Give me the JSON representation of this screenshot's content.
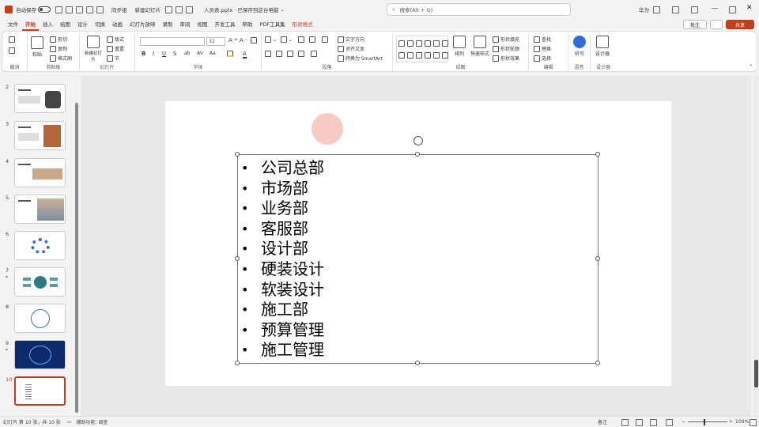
{
  "titlebar": {
    "autosave_label": "自动保存",
    "toggle_state": "关",
    "workspace_label": "同步组",
    "layout_label": "新建幻灯片",
    "file_title": "人员表.pptx · 已保存到这台电脑",
    "search_placeholder": "搜索(Alt + Q)",
    "user": "华为"
  },
  "menu": {
    "items": [
      "文件",
      "开始",
      "插入",
      "绘图",
      "设计",
      "切换",
      "动画",
      "幻灯片放映",
      "录制",
      "审阅",
      "视图",
      "开发工具",
      "帮助",
      "PDF工具集",
      "形状格式"
    ],
    "active": "开始",
    "contextual": "形状格式"
  },
  "header_buttons": {
    "comment": "批注",
    "share": "共享"
  },
  "ribbon": {
    "groups": [
      {
        "label": "撤消"
      },
      {
        "label": "剪贴板"
      },
      {
        "label": "幻灯片"
      },
      {
        "label": "字体"
      },
      {
        "label": "段落"
      },
      {
        "label": "绘图"
      },
      {
        "label": "编辑"
      },
      {
        "label": "语音"
      },
      {
        "label": "设计器"
      }
    ],
    "clipboard": {
      "paste": "粘贴",
      "cut": "剪切",
      "copy": "复制",
      "format_painter": "格式刷"
    },
    "slides": {
      "new_slide": "新建幻灯片",
      "layout": "版式",
      "reset": "重置",
      "section": "节"
    },
    "font": {
      "font_name": "",
      "font_size": "32"
    },
    "paragraph": {
      "text_direction": "文字方向",
      "align_text": "对齐文本",
      "smartart": "转换为 SmartArt"
    },
    "drawing": {
      "arrange": "排列",
      "quick_styles": "快速样式",
      "fill": "形状填充",
      "outline": "形状轮廓",
      "effects": "形状效果"
    },
    "editing": {
      "find": "查找",
      "replace": "替换",
      "select": "选择"
    },
    "voice": {
      "dictate": "听写"
    },
    "designer": {
      "designer": "设计器"
    }
  },
  "thumbnails": [
    {
      "num": "2",
      "style": "content"
    },
    {
      "num": "3",
      "style": "content"
    },
    {
      "num": "4",
      "style": "content"
    },
    {
      "num": "5",
      "style": "photo"
    },
    {
      "num": "6",
      "style": "dots"
    },
    {
      "num": "7",
      "style": "diagram",
      "star": "*"
    },
    {
      "num": "8",
      "style": "circle"
    },
    {
      "num": "9",
      "style": "dark",
      "star": "*"
    },
    {
      "num": "10",
      "style": "list",
      "selected": true
    }
  ],
  "slide": {
    "bullets": [
      "公司总部",
      "市场部",
      "业务部",
      "客服部",
      "设计部",
      "硬装设计",
      "软装设计",
      "施工部",
      "预算管理",
      "施工管理"
    ]
  },
  "status": {
    "slide_info": "幻灯片 第 10 张，共 10 张",
    "accessibility": "辅助功能: 调查",
    "notes": "备注",
    "zoom": "100%"
  },
  "colors": {
    "accent": "#c43e1c",
    "dark_slide": "#0d2a6b"
  }
}
